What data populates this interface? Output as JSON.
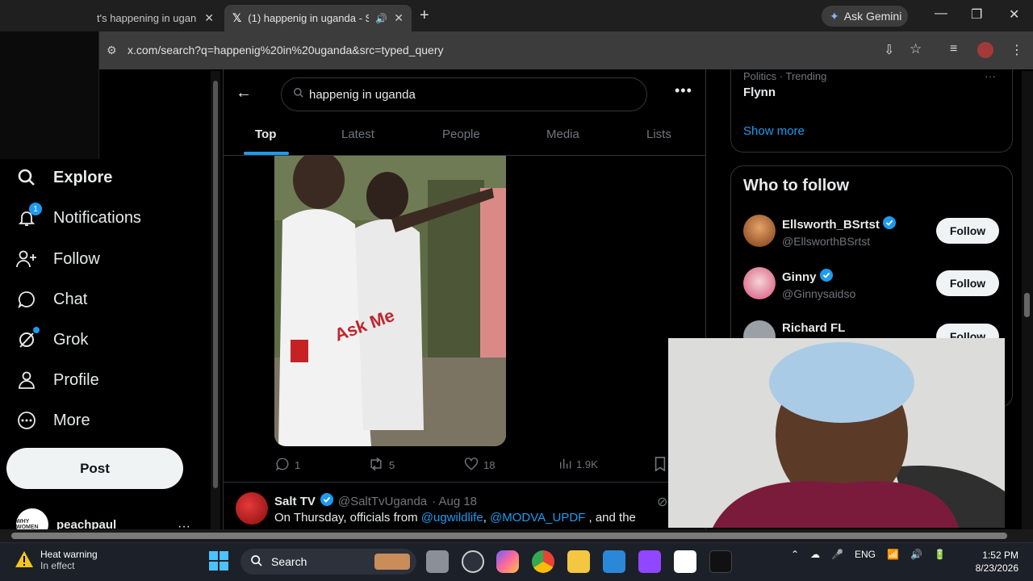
{
  "browser": {
    "tabs": [
      {
        "title": "t's happening in ugan"
      },
      {
        "title": "(1) happenig in uganda - Se"
      }
    ],
    "ask_gemini": "Ask Gemini",
    "url": "x.com/search?q=happenig%20in%20uganda&src=typed_query"
  },
  "nav": {
    "items": [
      {
        "label": "Explore"
      },
      {
        "label": "Notifications",
        "badge": "1"
      },
      {
        "label": "Follow"
      },
      {
        "label": "Chat"
      },
      {
        "label": "Grok"
      },
      {
        "label": "Profile"
      },
      {
        "label": "More"
      }
    ],
    "post_label": "Post",
    "account_name": "peachpaul",
    "account_avatar_text": "WHY WOMEN"
  },
  "search": {
    "query": "happenig in uganda",
    "tabs": [
      "Top",
      "Latest",
      "People",
      "Media",
      "Lists"
    ]
  },
  "tweet1": {
    "replies": "1",
    "reposts": "5",
    "likes": "18",
    "views": "1.9K"
  },
  "tweet2": {
    "name": "Salt TV",
    "handle": "@SaltTvUganda",
    "date": "· Aug 18",
    "text_prefix": "On Thursday, officials from",
    "mention1": "@ugwildlife",
    "comma": ",",
    "mention2": "@MODVA_UPDF",
    "text_suffix": ", and the"
  },
  "sidebar": {
    "trend_category": "Politics · Trending",
    "trend_name": "Flynn",
    "show_more": "Show more",
    "who_to_follow_title": "Who to follow",
    "suggestions": [
      {
        "name": "Ellsworth_BSrtst",
        "handle": "@EllsworthBSrtst",
        "button": "Follow"
      },
      {
        "name": "Ginny",
        "handle": "@Ginnysaidso",
        "button": "Follow"
      },
      {
        "name": "Richard FL",
        "button": "Follow"
      }
    ]
  },
  "taskbar": {
    "weather_title": "Heat warning",
    "weather_sub": "In effect",
    "search_label": "Search",
    "lang": "ENG",
    "time": "1:52 PM",
    "date": "8/23/2026"
  }
}
